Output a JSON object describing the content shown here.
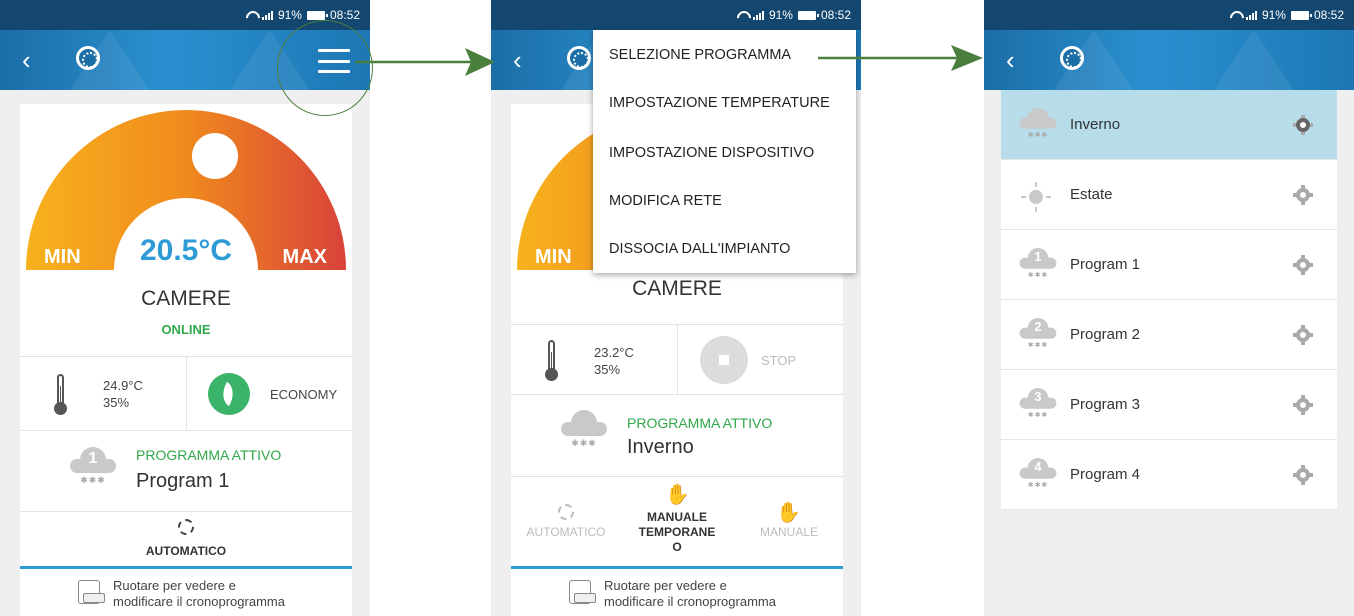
{
  "status_bar": {
    "signal": "91%",
    "time": "08:52"
  },
  "screen1": {
    "gauge": {
      "min_label": "MIN",
      "max_label": "MAX",
      "temperature": "20.5°C"
    },
    "zone": {
      "name": "CAMERE",
      "status": "ONLINE"
    },
    "sensor": {
      "temperature": "24.9°C",
      "humidity": "35%"
    },
    "mode": {
      "label": "ECONOMY"
    },
    "program": {
      "title": "PROGRAMMA ATTIVO",
      "name": "Program 1",
      "number": "1"
    },
    "operation": {
      "label": "AUTOMATICO"
    },
    "hint": {
      "line1": "Ruotare per vedere e",
      "line2": "modificare il cronoprogramma"
    }
  },
  "screen2": {
    "gauge": {
      "min_label": "MIN"
    },
    "zone": {
      "name": "CAMERE"
    },
    "sensor": {
      "temperature": "23.2°C",
      "humidity": "35%"
    },
    "mode": {
      "label": "STOP"
    },
    "program": {
      "title": "PROGRAMMA ATTIVO",
      "name": "Inverno"
    },
    "modes": {
      "auto": "AUTOMATICO",
      "temp_line1": "MANUALE",
      "temp_line2": "TEMPORANE",
      "temp_line3": "O",
      "manual": "MANUALE"
    },
    "hint": {
      "line1": "Ruotare per vedere e",
      "line2": "modificare il cronoprogramma"
    },
    "menu": {
      "items": [
        "SELEZIONE PROGRAMMA",
        "IMPOSTAZIONE TEMPERATURE",
        "IMPOSTAZIONE DISPOSITIVO",
        "MODIFICA RETE",
        "DISSOCIA DALL'IMPIANTO"
      ]
    }
  },
  "screen3": {
    "programs": [
      {
        "name": "Inverno",
        "icon": "cloud-snow-icon",
        "selected": true
      },
      {
        "name": "Estate",
        "icon": "sun-icon",
        "selected": false
      },
      {
        "name": "Program 1",
        "icon": "cloud-1-icon",
        "number": "1",
        "selected": false
      },
      {
        "name": "Program 2",
        "icon": "cloud-2-icon",
        "number": "2",
        "selected": false
      },
      {
        "name": "Program 3",
        "icon": "cloud-3-icon",
        "number": "3",
        "selected": false
      },
      {
        "name": "Program 4",
        "icon": "cloud-4-icon",
        "number": "4",
        "selected": false
      }
    ]
  },
  "colors": {
    "status_bar": "#13476f",
    "app_bar": "#2a8fcf",
    "accent_green": "#2fa849",
    "accent_blue": "#2e9bd6",
    "selected_row": "#b7dcea",
    "arrow_green": "#4b7f3e"
  }
}
